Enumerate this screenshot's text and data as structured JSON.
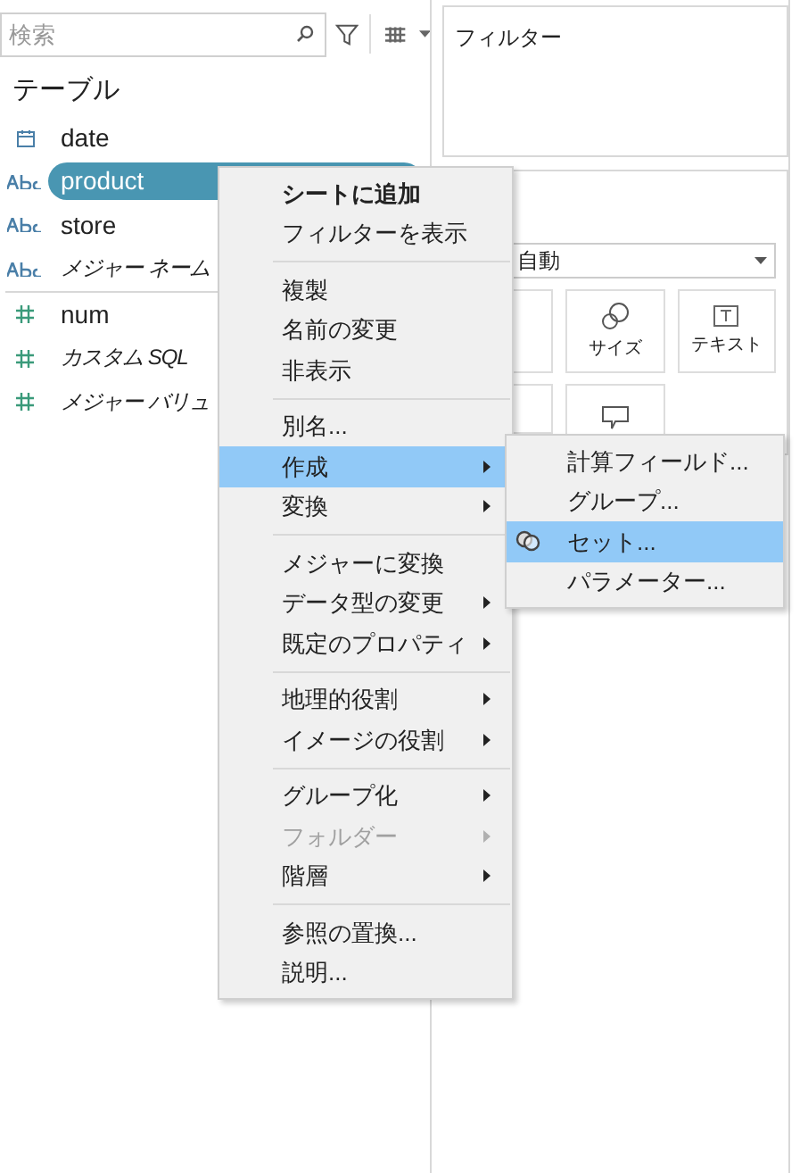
{
  "search": {
    "placeholder": "検索"
  },
  "fields_header": "テーブル",
  "fields": [
    {
      "kind": "date",
      "label": "date",
      "italic": false,
      "selected": false
    },
    {
      "kind": "text",
      "label": "product",
      "italic": false,
      "selected": true
    },
    {
      "kind": "text",
      "label": "store",
      "italic": false,
      "selected": false
    },
    {
      "kind": "text",
      "label": "メジャー ネーム",
      "italic": true,
      "selected": false
    },
    {
      "kind": "divider"
    },
    {
      "kind": "number",
      "label": "num",
      "italic": false,
      "selected": false
    },
    {
      "kind": "number",
      "label": "カスタム SQL",
      "italic": true,
      "selected": false
    },
    {
      "kind": "number",
      "label": "メジャー バリュ",
      "italic": true,
      "selected": false
    }
  ],
  "filters_card": {
    "title": "フィルター"
  },
  "marks_card": {
    "mark_type": "自動",
    "buttons": [
      {
        "kind": "size",
        "label": "サイズ"
      },
      {
        "kind": "text",
        "label": "テキスト"
      },
      {
        "kind": "tooltip"
      }
    ]
  },
  "context_menu": [
    {
      "kind": "item",
      "label": "シートに追加",
      "bold": true,
      "submenu": false,
      "disabled": false,
      "selected": false
    },
    {
      "kind": "item",
      "label": "フィルターを表示",
      "bold": false,
      "submenu": false,
      "disabled": false,
      "selected": false
    },
    {
      "kind": "separator"
    },
    {
      "kind": "item",
      "label": "複製",
      "bold": false,
      "submenu": false,
      "disabled": false,
      "selected": false
    },
    {
      "kind": "item",
      "label": "名前の変更",
      "bold": false,
      "submenu": false,
      "disabled": false,
      "selected": false
    },
    {
      "kind": "item",
      "label": "非表示",
      "bold": false,
      "submenu": false,
      "disabled": false,
      "selected": false
    },
    {
      "kind": "separator"
    },
    {
      "kind": "item",
      "label": "別名...",
      "bold": false,
      "submenu": false,
      "disabled": false,
      "selected": false
    },
    {
      "kind": "item",
      "label": "作成",
      "bold": false,
      "submenu": true,
      "disabled": false,
      "selected": true
    },
    {
      "kind": "item",
      "label": "変換",
      "bold": false,
      "submenu": true,
      "disabled": false,
      "selected": false
    },
    {
      "kind": "separator"
    },
    {
      "kind": "item",
      "label": "メジャーに変換",
      "bold": false,
      "submenu": false,
      "disabled": false,
      "selected": false
    },
    {
      "kind": "item",
      "label": "データ型の変更",
      "bold": false,
      "submenu": true,
      "disabled": false,
      "selected": false
    },
    {
      "kind": "item",
      "label": "既定のプロパティ",
      "bold": false,
      "submenu": true,
      "disabled": false,
      "selected": false
    },
    {
      "kind": "separator"
    },
    {
      "kind": "item",
      "label": "地理的役割",
      "bold": false,
      "submenu": true,
      "disabled": false,
      "selected": false
    },
    {
      "kind": "item",
      "label": "イメージの役割",
      "bold": false,
      "submenu": true,
      "disabled": false,
      "selected": false
    },
    {
      "kind": "separator"
    },
    {
      "kind": "item",
      "label": "グループ化",
      "bold": false,
      "submenu": true,
      "disabled": false,
      "selected": false
    },
    {
      "kind": "item",
      "label": "フォルダー",
      "bold": false,
      "submenu": true,
      "disabled": true,
      "selected": false
    },
    {
      "kind": "item",
      "label": "階層",
      "bold": false,
      "submenu": true,
      "disabled": false,
      "selected": false
    },
    {
      "kind": "separator"
    },
    {
      "kind": "item",
      "label": "参照の置換...",
      "bold": false,
      "submenu": false,
      "disabled": false,
      "selected": false
    },
    {
      "kind": "item",
      "label": "説明...",
      "bold": false,
      "submenu": false,
      "disabled": false,
      "selected": false
    }
  ],
  "submenu": [
    {
      "label": "計算フィールド...",
      "icon": false,
      "selected": false
    },
    {
      "label": "グループ...",
      "icon": false,
      "selected": false
    },
    {
      "label": "セット...",
      "icon": true,
      "selected": true
    },
    {
      "label": "パラメーター...",
      "icon": false,
      "selected": false
    }
  ]
}
